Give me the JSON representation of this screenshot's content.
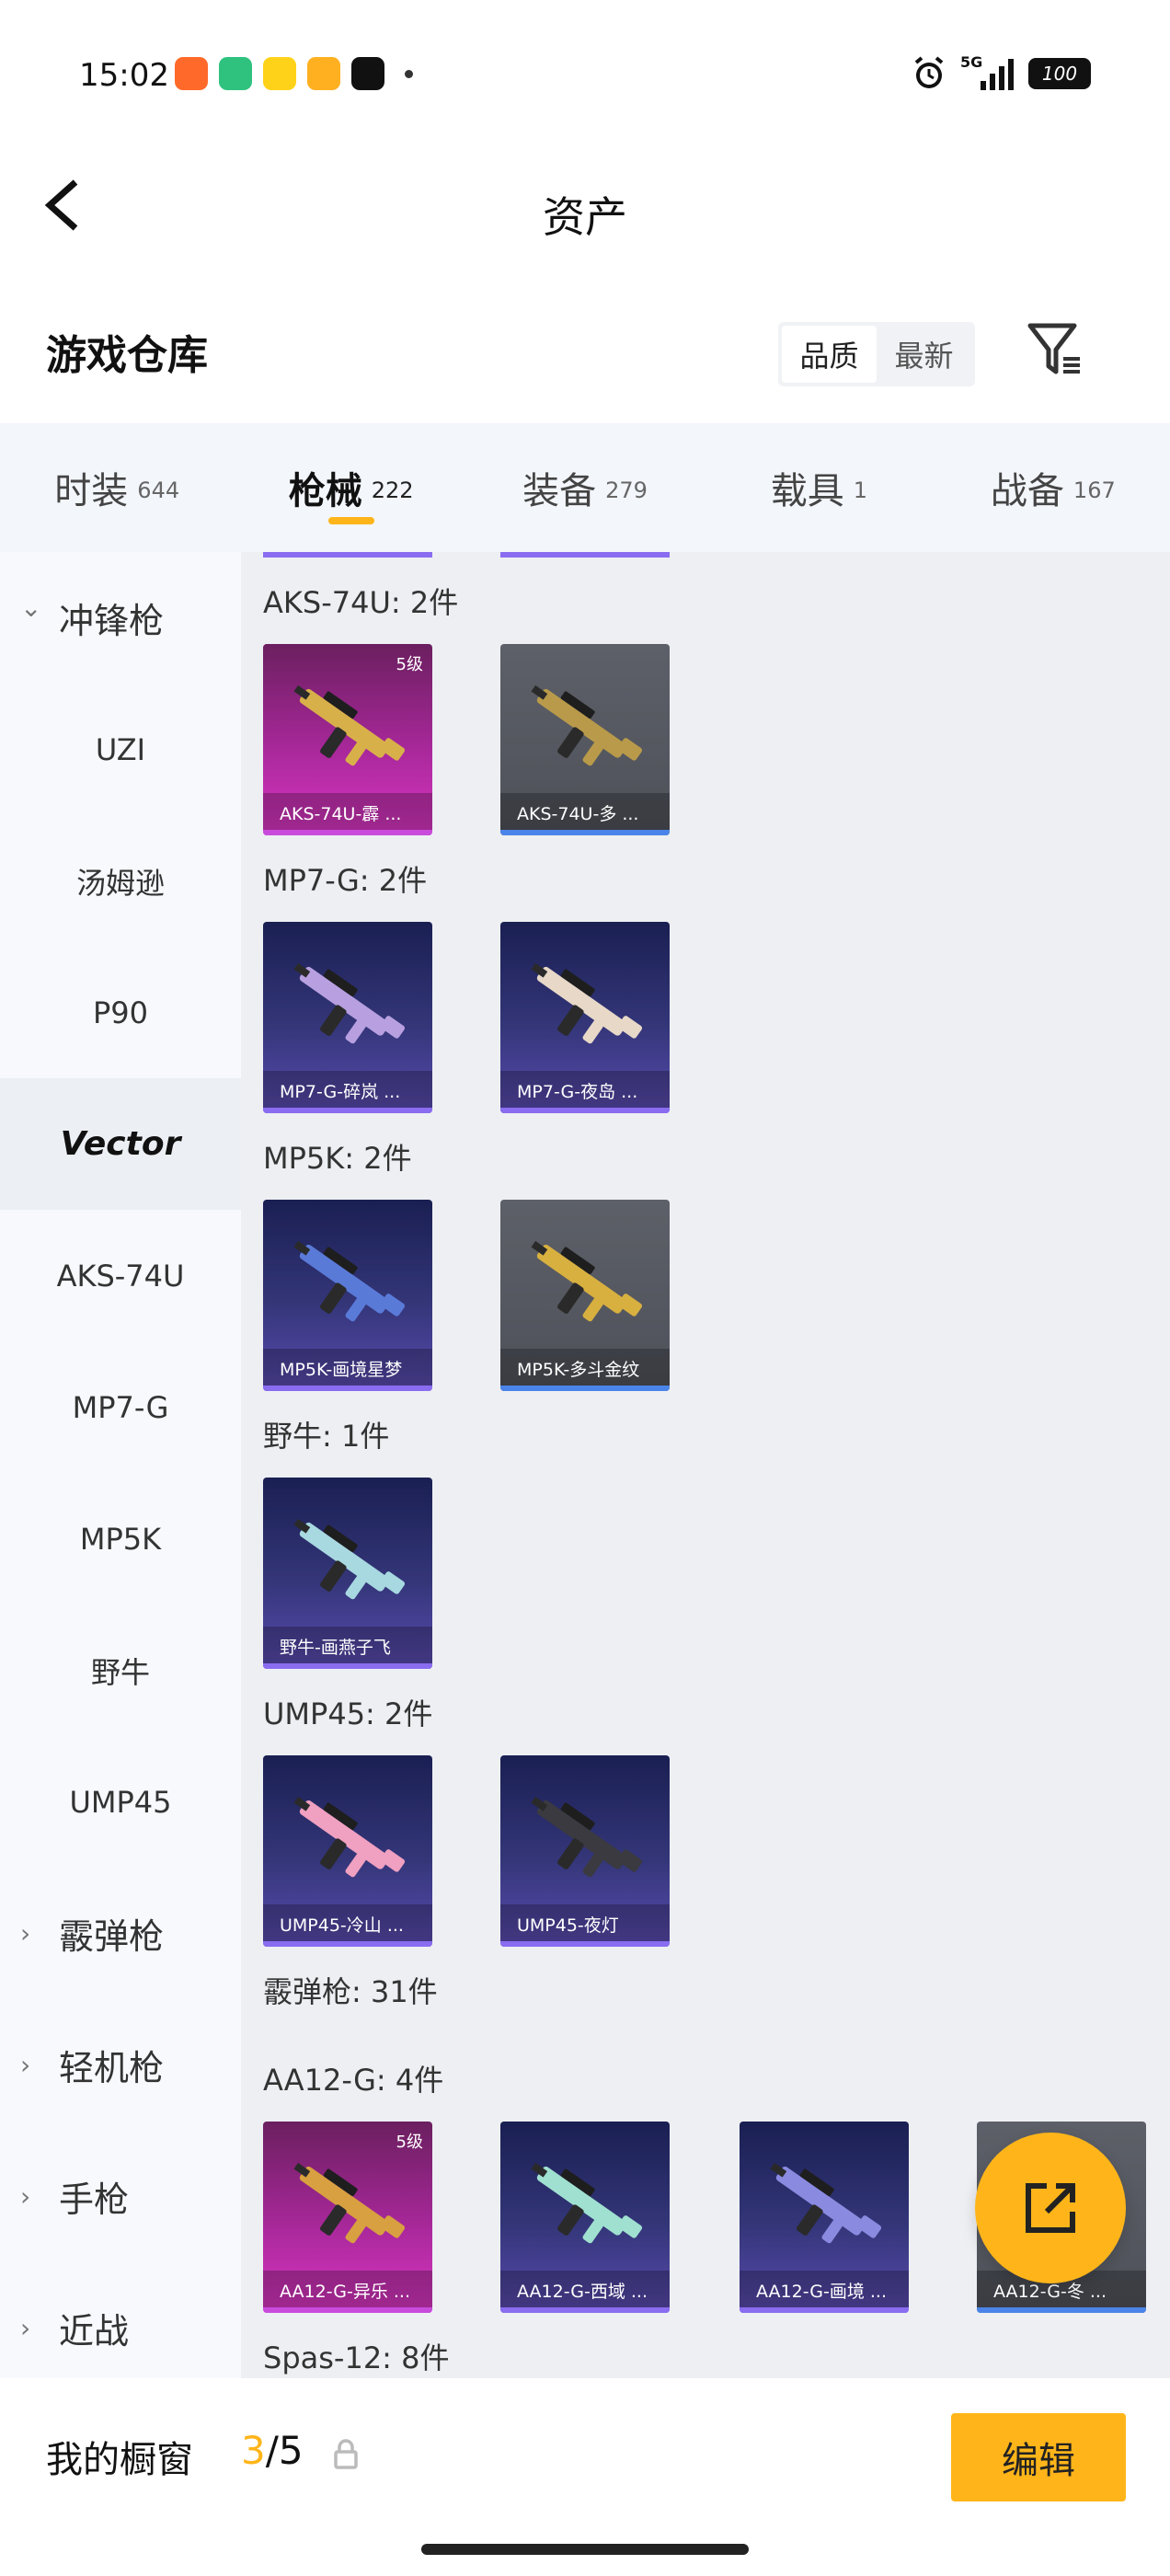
{
  "status_bar": {
    "time": "15:02",
    "network": "5G",
    "battery": "100",
    "app_icons": [
      "app-icon-orange",
      "app-icon-green",
      "app-icon-yellow",
      "app-icon-video",
      "tiktok-icon"
    ],
    "app_colors": [
      "#ff6a2a",
      "#2ec27e",
      "#ffd21a",
      "#ffb020",
      "#111111"
    ]
  },
  "nav": {
    "title": "资产"
  },
  "warehouse": {
    "title": "游戏仓库",
    "sort_options": [
      "品质",
      "最新"
    ],
    "sort_active": 0
  },
  "tabs": [
    {
      "label": "时装",
      "count": "644"
    },
    {
      "label": "枪械",
      "count": "222"
    },
    {
      "label": "装备",
      "count": "279"
    },
    {
      "label": "载具",
      "count": "1"
    },
    {
      "label": "战备",
      "count": "167"
    }
  ],
  "active_tab": 1,
  "sidebar": [
    {
      "label": "冲锋枪",
      "type": "group",
      "expanded": true
    },
    {
      "label": "UZI",
      "type": "item"
    },
    {
      "label": "汤姆逊",
      "type": "item"
    },
    {
      "label": "P90",
      "type": "item"
    },
    {
      "label": "Vector",
      "type": "item",
      "selected": true
    },
    {
      "label": "AKS-74U",
      "type": "item"
    },
    {
      "label": "MP7-G",
      "type": "item"
    },
    {
      "label": "MP5K",
      "type": "item"
    },
    {
      "label": "野牛",
      "type": "item"
    },
    {
      "label": "UMP45",
      "type": "item"
    },
    {
      "label": "霰弹枪",
      "type": "group",
      "expanded": false
    },
    {
      "label": "轻机枪",
      "type": "group",
      "expanded": false
    },
    {
      "label": "手枪",
      "type": "group",
      "expanded": false
    },
    {
      "label": "近战",
      "type": "group",
      "expanded": false
    }
  ],
  "sections": [
    {
      "title": "AKS-74U: 2件",
      "cards": [
        {
          "name": "AKS-74U-霹 ...",
          "style": "pink",
          "level": "5级",
          "gun": "#d8b04a"
        },
        {
          "name": "AKS-74U-多 ...",
          "style": "gray",
          "level": "",
          "gun": "#b89a4a"
        }
      ]
    },
    {
      "title": "MP7-G: 2件",
      "cards": [
        {
          "name": "MP7-G-碎岚 ...",
          "style": "purple",
          "level": "",
          "gun": "#b8a0e0"
        },
        {
          "name": "MP7-G-夜岛 ...",
          "style": "purple",
          "level": "",
          "gun": "#e8d8c8"
        }
      ]
    },
    {
      "title": "MP5K: 2件",
      "cards": [
        {
          "name": "MP5K-画境星梦",
          "style": "purple",
          "level": "",
          "gun": "#5a7ad8"
        },
        {
          "name": "MP5K-多斗金纹",
          "style": "gray",
          "level": "",
          "gun": "#d8b040"
        }
      ]
    },
    {
      "title": "野牛: 1件",
      "cards": [
        {
          "name": "野牛-画燕子飞",
          "style": "purple",
          "level": "",
          "gun": "#a8d8e0"
        }
      ]
    },
    {
      "title": "UMP45: 2件",
      "cards": [
        {
          "name": "UMP45-冷山 ...",
          "style": "purple",
          "level": "",
          "gun": "#f0a0c0"
        },
        {
          "name": "UMP45-夜灯",
          "style": "purple",
          "level": "",
          "gun": "#3a3a40"
        }
      ]
    },
    {
      "title": "霰弹枪: 31件",
      "cards": []
    },
    {
      "title": "AA12-G: 4件",
      "cards": [
        {
          "name": "AA12-G-异乐 ...",
          "style": "pink",
          "level": "5级",
          "gun": "#d8a040"
        },
        {
          "name": "AA12-G-西域 ...",
          "style": "purple",
          "level": "",
          "gun": "#a0e0d0"
        },
        {
          "name": "AA12-G-画境 ...",
          "style": "purple",
          "level": "",
          "gun": "#8a8ae0"
        },
        {
          "name": "AA12-G-冬 ...",
          "style": "gray",
          "level": "",
          "gun": "#c8c8c8"
        }
      ]
    },
    {
      "title": "Spas-12: 8件",
      "cards": []
    }
  ],
  "bottom": {
    "label": "我的橱窗",
    "current": "3",
    "total": "/5",
    "edit_label": "编辑"
  }
}
